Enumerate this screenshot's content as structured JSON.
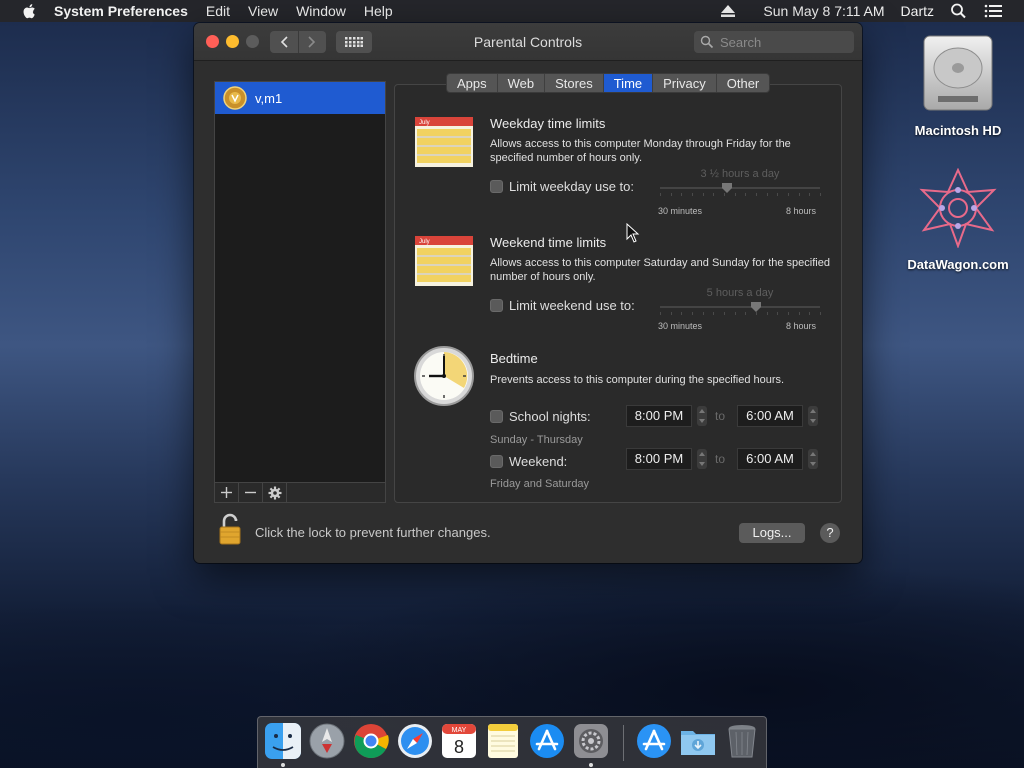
{
  "menubar": {
    "app_name": "System Preferences",
    "items": [
      "Edit",
      "View",
      "Window",
      "Help"
    ],
    "clock": "Sun May 8  7:11 AM",
    "user": "Dartz"
  },
  "desktop": {
    "icons": [
      {
        "label": "Macintosh HD",
        "icon": "hard-drive-icon"
      },
      {
        "label": "DataWagon.com",
        "icon": "datawagon-icon"
      }
    ]
  },
  "window": {
    "title": "Parental Controls",
    "search_placeholder": "Search"
  },
  "users": [
    {
      "name": "v,m1",
      "selected": true
    }
  ],
  "tabs": [
    {
      "label": "Apps",
      "active": false
    },
    {
      "label": "Web",
      "active": false
    },
    {
      "label": "Stores",
      "active": false
    },
    {
      "label": "Time",
      "active": true
    },
    {
      "label": "Privacy",
      "active": false
    },
    {
      "label": "Other",
      "active": false
    }
  ],
  "weekday": {
    "title": "Weekday time limits",
    "description": "Allows access to this computer Monday through Friday for the specified number of hours only.",
    "checkbox_label": "Limit weekday use to:",
    "checked": false,
    "slider_value_label": "3 ½ hours a day",
    "slider_fraction": 0.42,
    "range_min": "30 minutes",
    "range_max": "8 hours",
    "calendar_month": "July"
  },
  "weekend": {
    "title": "Weekend time limits",
    "description": "Allows access to this computer Saturday and Sunday for the specified number of hours only.",
    "checkbox_label": "Limit weekend use to:",
    "checked": false,
    "slider_value_label": "5 hours a day",
    "slider_fraction": 0.6,
    "range_min": "30 minutes",
    "range_max": "8 hours",
    "calendar_month": "July"
  },
  "bedtime": {
    "title": "Bedtime",
    "description": "Prevents access to this computer during the specified hours.",
    "to_label": "to",
    "school_nights": {
      "label": "School nights:",
      "checked": false,
      "from": "8:00 PM",
      "to": "6:00 AM",
      "days": "Sunday - Thursday"
    },
    "weekend": {
      "label": "Weekend:",
      "checked": false,
      "from": "8:00 PM",
      "to": "6:00 AM",
      "days": "Friday and Saturday"
    }
  },
  "footer": {
    "lock_text": "Click the lock to prevent further changes.",
    "logs_label": "Logs...",
    "help_label": "?"
  },
  "dock": {
    "items": [
      "finder-icon",
      "launchpad-icon",
      "chrome-icon",
      "safari-icon",
      "calendar-icon",
      "notes-icon",
      "app-store-icon",
      "system-preferences-icon",
      "app-store-download-icon",
      "downloads-folder-icon",
      "trash-icon"
    ],
    "calendar_month": "MAY",
    "calendar_day": "8"
  },
  "colors": {
    "accent": "#1f5bd1",
    "window_bg": "#2e2e2e",
    "close": "#ff5f57",
    "minimize": "#febc2e"
  }
}
